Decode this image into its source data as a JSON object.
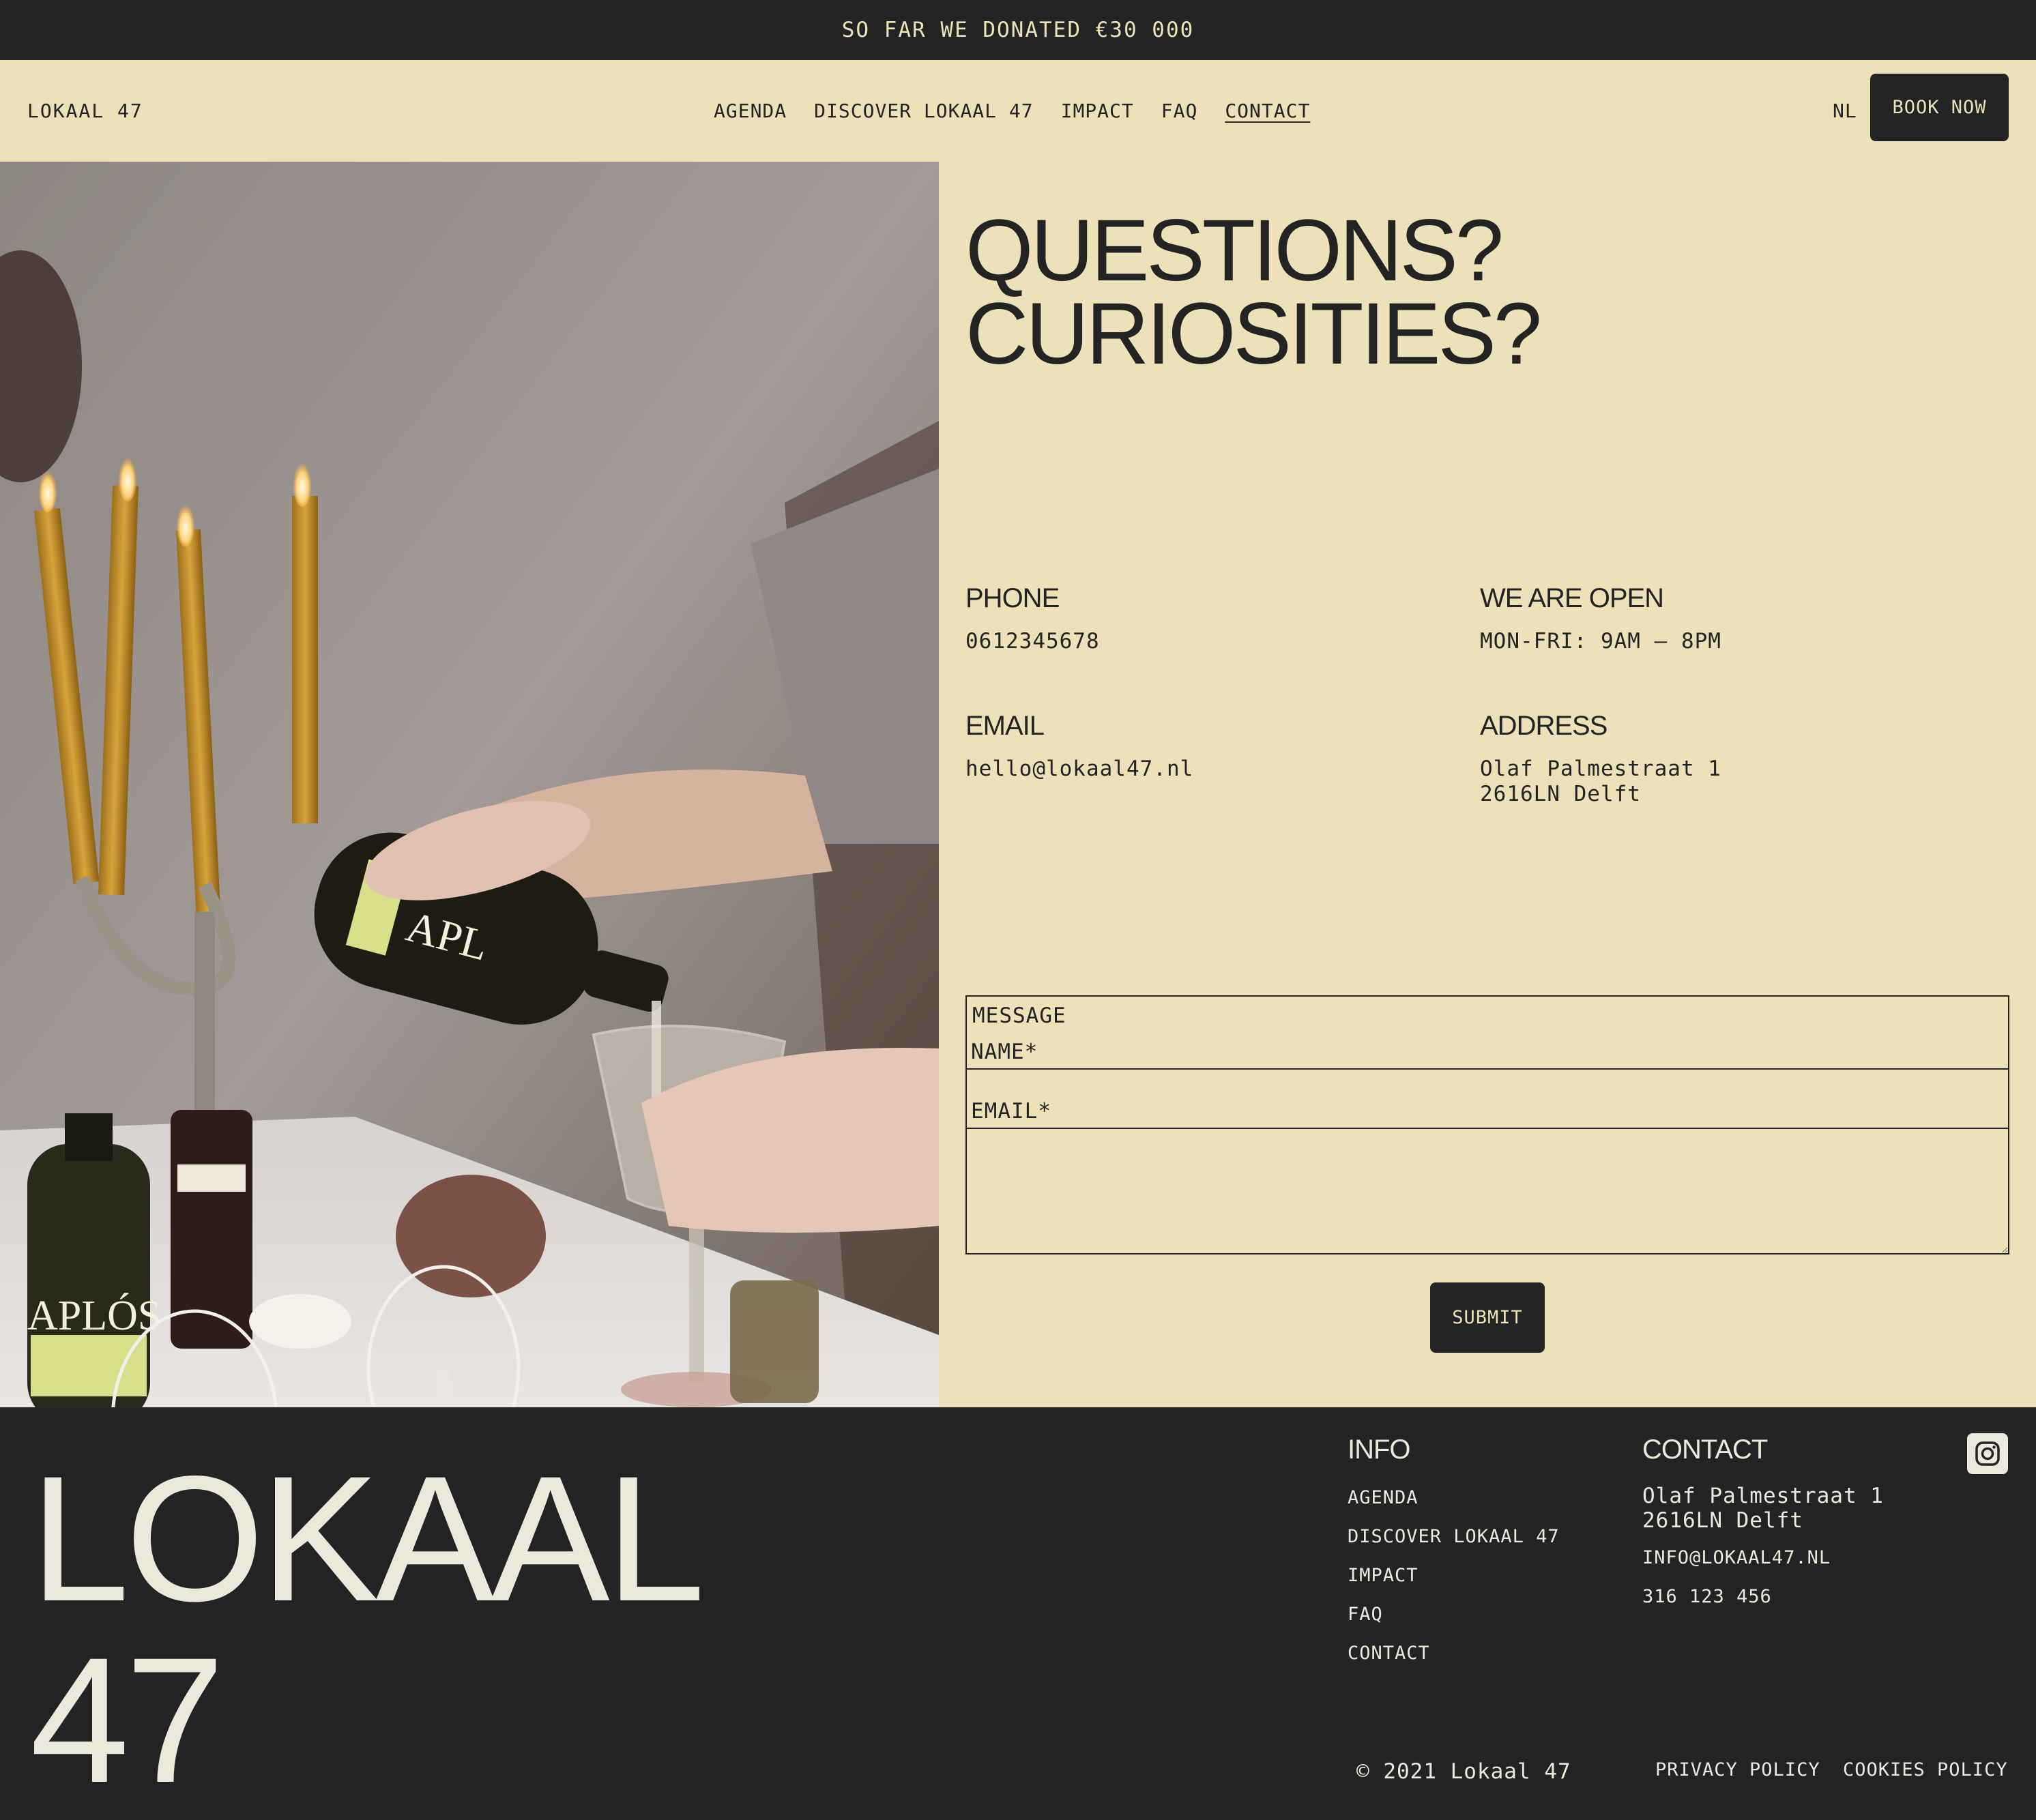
{
  "announcement": "SO FAR WE DONATED €30 000",
  "header": {
    "logo": "LOKAAL 47",
    "nav": [
      {
        "label": "AGENDA"
      },
      {
        "label": "DISCOVER LOKAAL 47"
      },
      {
        "label": "IMPACT"
      },
      {
        "label": "FAQ"
      },
      {
        "label": "CONTACT"
      }
    ],
    "active_nav": "CONTACT",
    "language": "NL",
    "book_label": "BOOK NOW"
  },
  "hero_image": {
    "description_icon": "photo-wine-pouring",
    "bottle_label": "APLÓS"
  },
  "contact": {
    "heading_line1": "QUESTIONS?",
    "heading_line2": "CURIOSITIES?",
    "phone": {
      "title": "PHONE",
      "value": "0612345678"
    },
    "hours": {
      "title": "WE ARE OPEN",
      "value": "MON-FRI: 9AM — 8PM"
    },
    "email": {
      "title": "EMAIL",
      "value": "hello@lokaal47.nl"
    },
    "address": {
      "title": "ADDRESS",
      "line1": "Olaf Palmestraat 1",
      "line2": "2616LN Delft"
    }
  },
  "form": {
    "name_placeholder": "NAME*",
    "email_placeholder": "EMAIL*",
    "message_placeholder": "MESSAGE",
    "submit_label": "SUBMIT"
  },
  "footer": {
    "logo_line1": "LOKAAL",
    "logo_line2": "47",
    "info_title": "INFO",
    "info_links": [
      {
        "label": "AGENDA"
      },
      {
        "label": "DISCOVER LOKAAL 47"
      },
      {
        "label": "IMPACT"
      },
      {
        "label": "FAQ"
      },
      {
        "label": "CONTACT"
      }
    ],
    "contact_title": "CONTACT",
    "address_line1": "Olaf Palmestraat 1",
    "address_line2": "2616LN Delft",
    "email": "INFO@LOKAAL47.NL",
    "phone": "316 123 456",
    "social_icon": "instagram-icon",
    "copyright": "© 2021 Lokaal 47",
    "privacy": "PRIVACY POLICY",
    "cookies": "COOKIES POLICY"
  },
  "colors": {
    "dark": "#232323",
    "cream": "#ece1b8",
    "footer_text": "#ece9dc"
  }
}
